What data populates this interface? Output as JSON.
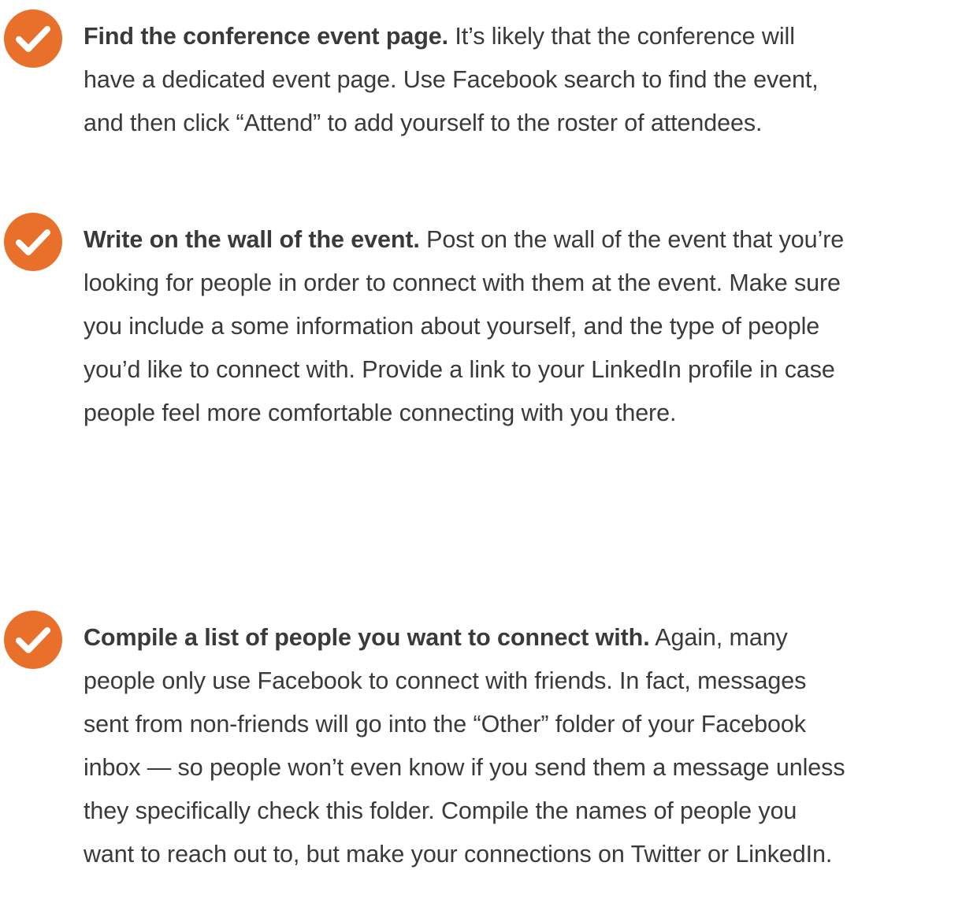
{
  "accent_color": "#e8702a",
  "items": [
    {
      "icon": "check-circle-icon",
      "lead": "Find the conference event page.",
      "lines": [
        " It’s likely that the conference will",
        "have a dedicated event page. Use Facebook search to find the event,",
        "and then click “Attend” to add yourself to the roster of attendees."
      ]
    },
    {
      "icon": "check-circle-icon",
      "lead": "Write on the wall of the event.",
      "lines": [
        " Post on the wall of the event that you’re",
        "looking for people in order to connect with them at the event. Make sure",
        "you include a some information about yourself, and the type of people",
        "you’d like to connect with. Provide a link to your LinkedIn profile in case",
        "people feel more comfortable connecting with you there."
      ]
    },
    {
      "icon": "check-circle-icon",
      "lead": "Compile a list of people you want to connect with.",
      "lines": [
        " Again, many",
        "people only use Facebook to connect with friends. In fact, messages",
        "sent from non-friends will go into the “Other” folder of your Facebook",
        "inbox — so people won’t even know if you send them a message unless",
        "they specifically check this folder. Compile the names of people you",
        "want to reach out to, but make your connections on Twitter or LinkedIn."
      ]
    }
  ]
}
